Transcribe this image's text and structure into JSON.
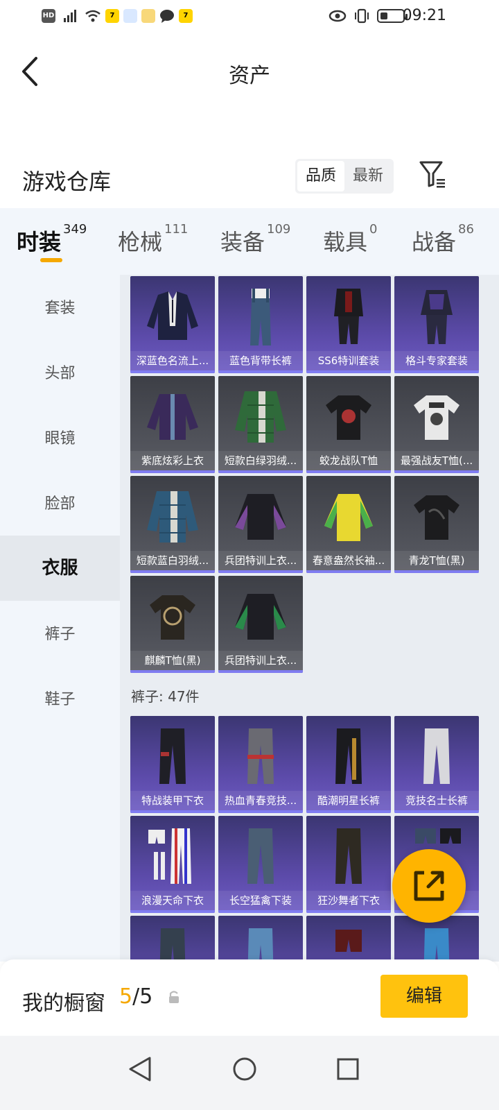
{
  "status_bar": {
    "time": "09:21"
  },
  "header": {
    "title": "资产"
  },
  "warehouse": {
    "title": "游戏仓库",
    "sort_options": [
      "品质",
      "最新"
    ]
  },
  "tabs": [
    {
      "label": "时装",
      "count": "349"
    },
    {
      "label": "枪械",
      "count": "111"
    },
    {
      "label": "装备",
      "count": "109"
    },
    {
      "label": "载具",
      "count": "0"
    },
    {
      "label": "战备",
      "count": "86"
    }
  ],
  "side_nav": [
    "套装",
    "头部",
    "眼镜",
    "脸部",
    "衣服",
    "裤子",
    "鞋子"
  ],
  "clothes_items": [
    "深蓝色名流上...",
    "蓝色背带长裤",
    "SS6特训套装",
    "格斗专家套装",
    "紫底炫彩上衣",
    "短款白绿羽绒...",
    "蛟龙战队T恤",
    "最强战友T恤(...",
    "短款蓝白羽绒...",
    "兵团特训上衣...",
    "春意盎然长袖...",
    "青龙T恤(黑)",
    "麒麟T恤(黑)",
    "兵团特训上衣..."
  ],
  "pants_section": {
    "label": "裤子: 47件"
  },
  "pants_items": [
    "特战装甲下衣",
    "热血青春竞技...",
    "酷潮明星长裤",
    "竞技名士长裤",
    "浪漫天命下衣",
    "长空猛禽下装",
    "狂沙舞者下衣",
    ""
  ],
  "bottom_bar": {
    "window_label": "我的橱窗",
    "window_current": "5",
    "window_sep": "/",
    "window_total": "5",
    "edit_label": "编辑"
  },
  "colors": {
    "accent": "#f5a800",
    "edit_button": "#ffc20e",
    "card_purple": "#5b4aa8",
    "card_gray": "#4a4c54"
  }
}
